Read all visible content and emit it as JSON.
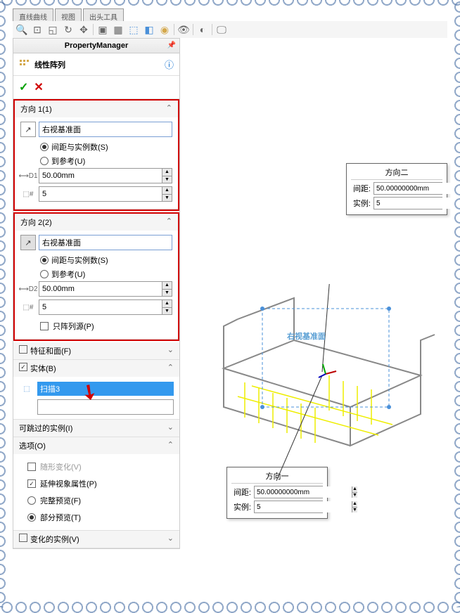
{
  "header": {
    "pm": "PropertyManager",
    "feature": "线性阵列"
  },
  "tabs": [
    "直线曲线",
    "视图",
    "出头工具"
  ],
  "dir1": {
    "title": "方向 1(1)",
    "ref": "右视基准面",
    "r1": "间距与实例数(S)",
    "r2": "到参考(U)",
    "dist": "50.00mm",
    "count": "5"
  },
  "dir2": {
    "title": "方向 2(2)",
    "ref": "右视基准面",
    "r1": "间距与实例数(S)",
    "r2": "到参考(U)",
    "dist": "50.00mm",
    "count": "5"
  },
  "only_source": "只阵列源(P)",
  "feat_faces": "特征和面(F)",
  "bodies": {
    "title": "实体(B)",
    "item": "扫描3"
  },
  "skip": "可跳过的实例(I)",
  "options": {
    "title": "选项(O)",
    "o1": "随形变化(V)",
    "o2": "延伸视象属性(P)",
    "o3": "完整预览(F)",
    "o4": "部分预览(T)"
  },
  "change_inst": "变化的实例(V)",
  "callout1": {
    "title": "方向二",
    "l1": "间距:",
    "v1": "50.00000000mm",
    "l2": "实例:",
    "v2": "5"
  },
  "callout2": {
    "title": "方向一",
    "l1": "间距:",
    "v1": "50.00000000mm",
    "l2": "实例:",
    "v2": "5"
  },
  "model_label": "右视基准面"
}
